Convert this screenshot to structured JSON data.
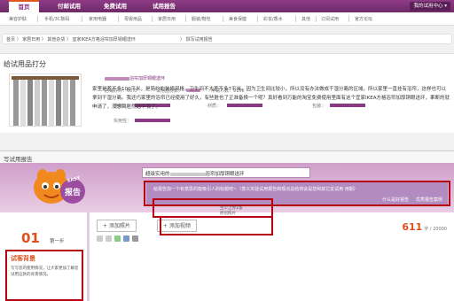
{
  "topnav": {
    "tabs": [
      {
        "label": "首页",
        "active": true
      },
      {
        "label": "付邮试用",
        "active": false
      },
      {
        "label": "免费试用",
        "active": false
      },
      {
        "label": "试用报告",
        "active": false
      }
    ],
    "my_center": "我的试用中心 ▾"
  },
  "subnav": {
    "items": [
      "美容护肤",
      "手机/3C数码",
      "家用电器",
      "母婴用品",
      "家居日用",
      "服装/鞋包",
      "美食保健",
      "彩妆/香水",
      "其他",
      "订阅试用",
      "官方论坛"
    ]
  },
  "breadcrumb": {
    "path": "首页 〉 家居日用 〉 其他杂货 〉 宜家IKEA方格浴帘加厚铜眼送环",
    "current": "〉 撰写试用报告"
  },
  "product": {
    "section_title": "给试用品打分",
    "name_suffix": "浴帘加厚铜眼送环",
    "rating_label": "店铺好评：66.0",
    "count_label": "试用品份数：",
    "applicants_label": "申请人数：9156",
    "score_labels": [
      "性价比：",
      "材质：",
      "包装：",
      "实用性："
    ]
  },
  "report": {
    "section_title": "写试用报告",
    "title_value_prefix": "超级实用的",
    "title_value_suffix": "浴帘加厚铜眼送环",
    "tip_text": "给报告加一个有意思的能吸引人的标题吧~（意义实验试用报告和观点总结将会是您和其它友试用 用期）",
    "tip_link_1": "什么是好报告",
    "tip_link_2": "优秀报告案例",
    "mascot_text": "报告",
    "mascot_badge": "EASY"
  },
  "step": {
    "number": "01",
    "label": "第一步",
    "box_title": "试客背景",
    "box_desc": "写写您的使用情况，让大家更加了解您试用这款的背景情况。"
  },
  "editor": {
    "add_photo": "+ 添加照片",
    "add_video": "+ 添加视频",
    "video_hint_1": "至少上传1张",
    "video_hint_2": "原创照片",
    "char_count": "611",
    "char_max": "字 / 20000",
    "body_text": "家里是差不多100平米，是简约的装修风格，卫生间不大差不多7平米。因为卫生间比较小，所以没有办法做成干湿分离的区域，所以家里一直挂有浴帘，这样也可以拿到干湿分离。我还巧家里的浴帘已经使用了好久，有些脏也了正准备换一个呢？真好看到万能的淘宝免费使用里面有这个宜家IKEA方格浴帘加厚铜眼送环，果断的就申请了，没想到居然选中我了。"
  },
  "colors": {
    "brand_purple": "#7b2f74",
    "accent_orange": "#e04e1b",
    "highlight_red": "#b50010"
  }
}
